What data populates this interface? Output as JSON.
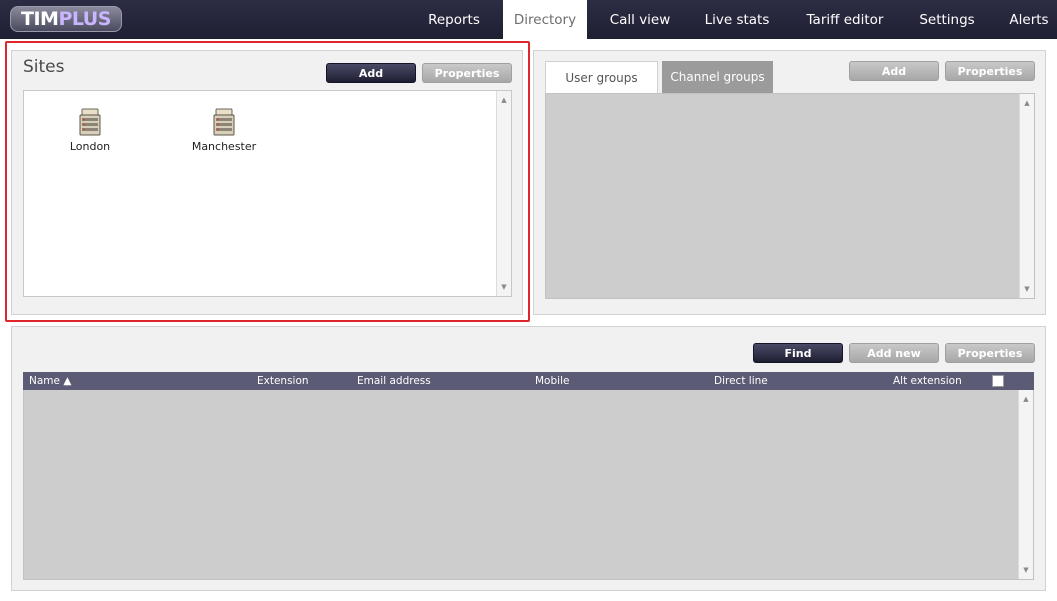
{
  "app": {
    "logo_primary": "TIM",
    "logo_secondary": "PLUS"
  },
  "nav": {
    "items": [
      {
        "label": "Reports"
      },
      {
        "label": "Directory"
      },
      {
        "label": "Call view"
      },
      {
        "label": "Live stats"
      },
      {
        "label": "Tariff editor"
      },
      {
        "label": "Settings"
      },
      {
        "label": "Alerts"
      }
    ],
    "active": "Directory"
  },
  "sites": {
    "title": "Sites",
    "add_label": "Add",
    "properties_label": "Properties",
    "items": [
      {
        "name": "London",
        "icon": "server-icon"
      },
      {
        "name": "Manchester",
        "icon": "server-icon"
      }
    ]
  },
  "groups": {
    "tabs": [
      {
        "label": "User groups"
      },
      {
        "label": "Channel groups"
      }
    ],
    "selected_tab": "User groups",
    "add_label": "Add",
    "properties_label": "Properties"
  },
  "directory": {
    "find_label": "Find",
    "add_new_label": "Add new",
    "properties_label": "Properties",
    "columns": [
      {
        "label": "Name ▲"
      },
      {
        "label": "Extension"
      },
      {
        "label": "Email address"
      },
      {
        "label": "Mobile"
      },
      {
        "label": "Direct line"
      },
      {
        "label": "Alt extension"
      }
    ],
    "rows": []
  },
  "colors": {
    "nav_bg": "#1f1f33",
    "highlight": "#e0262b",
    "header_bg": "#5b5b75",
    "dark_button": "#1e1e32",
    "grey_button": "#a7a7a7"
  }
}
